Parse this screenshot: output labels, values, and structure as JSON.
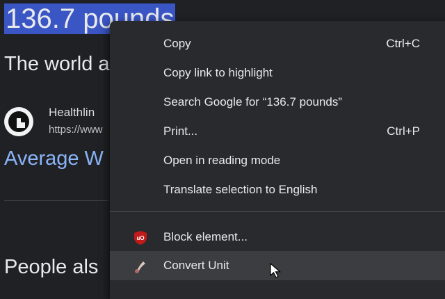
{
  "page": {
    "answer": "136.7 pounds",
    "subtitle": "The world a",
    "site_name": "Healthlin",
    "site_url": "https://www",
    "result_link": "Average W",
    "people_heading": "People als"
  },
  "context_menu": {
    "items": [
      {
        "label": "Copy",
        "shortcut": "Ctrl+C"
      },
      {
        "label": "Copy link to highlight",
        "shortcut": ""
      },
      {
        "label": "Search Google for “136.7 pounds”",
        "shortcut": ""
      },
      {
        "label": "Print...",
        "shortcut": "Ctrl+P"
      },
      {
        "label": "Open in reading mode",
        "shortcut": ""
      },
      {
        "label": "Translate selection to English",
        "shortcut": ""
      }
    ],
    "extensions": [
      {
        "label": "Block element...",
        "icon": "ublock-origin-icon",
        "icon_color": "#c21a1a"
      },
      {
        "label": "Convert Unit",
        "icon": "convert-unit-extension-icon",
        "hovered": true
      }
    ]
  },
  "colors": {
    "menu_bg": "#292a2d",
    "hover_bg": "#3c3d40",
    "selection": "#3a55c4",
    "link": "#8ab4f8"
  }
}
